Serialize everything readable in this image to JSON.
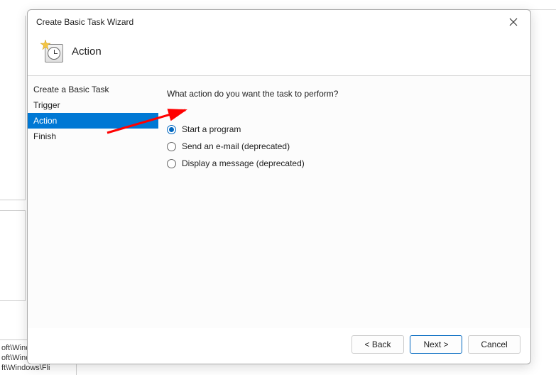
{
  "background": {
    "path_line_1": "oft\\Windo",
    "path_line_2": "oft\\Windows\\U...",
    "path_line_3": "ft\\Windows\\Fli"
  },
  "dialog": {
    "title": "Create Basic Task Wizard",
    "header_title": "Action",
    "nav": [
      {
        "label": "Create a Basic Task",
        "selected": false
      },
      {
        "label": "Trigger",
        "selected": false
      },
      {
        "label": "Action",
        "selected": true
      },
      {
        "label": "Finish",
        "selected": false
      }
    ],
    "prompt": "What action do you want the task to perform?",
    "options": [
      {
        "label": "Start a program",
        "checked": true
      },
      {
        "label": "Send an e-mail (deprecated)",
        "checked": false
      },
      {
        "label": "Display a message (deprecated)",
        "checked": false
      }
    ],
    "buttons": {
      "back": "< Back",
      "next": "Next >",
      "cancel": "Cancel"
    }
  },
  "annotation": {
    "arrow_color": "#ff0000"
  }
}
